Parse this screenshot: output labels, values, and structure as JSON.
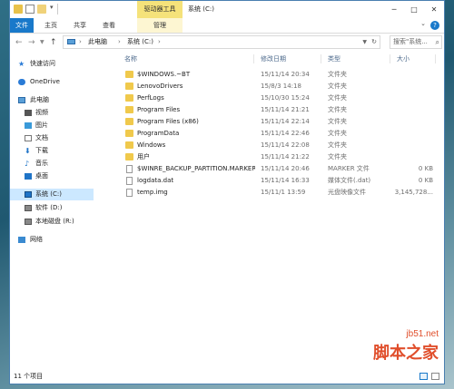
{
  "titlebar": {
    "context_tab_title": "驱动器工具",
    "window_title": "系统 (C:)",
    "dropdown_glyph": "▾"
  },
  "ribbon": {
    "tabs": [
      "文件",
      "主页",
      "共享",
      "查看",
      "管理"
    ],
    "help": "?"
  },
  "address": {
    "segments": [
      "此电脑",
      "系统 (C:)"
    ],
    "search_placeholder": "搜索\"系统...",
    "chevron": "›"
  },
  "sidebar": {
    "items": [
      {
        "label": "快速访问",
        "icon": "star-icon"
      },
      {
        "label": "OneDrive",
        "icon": "cloud-icon"
      },
      {
        "label": "此电脑",
        "icon": "pc-icon"
      },
      {
        "label": "视频",
        "icon": "video-icon"
      },
      {
        "label": "图片",
        "icon": "picture-icon"
      },
      {
        "label": "文档",
        "icon": "document-icon"
      },
      {
        "label": "下载",
        "icon": "download-icon"
      },
      {
        "label": "音乐",
        "icon": "music-icon"
      },
      {
        "label": "桌面",
        "icon": "desktop-icon"
      },
      {
        "label": "系统 (C:)",
        "icon": "windows-drive-icon",
        "selected": true
      },
      {
        "label": "软件 (D:)",
        "icon": "drive-icon"
      },
      {
        "label": "本地磁盘 (R:)",
        "icon": "drive-icon"
      },
      {
        "label": "网络",
        "icon": "network-icon"
      }
    ]
  },
  "list": {
    "columns": [
      "名称",
      "修改日期",
      "类型",
      "大小"
    ],
    "rows": [
      {
        "name": "$WINDOWS.~BT",
        "date": "15/11/14 20:34",
        "type": "文件夹",
        "size": "",
        "kind": "folder"
      },
      {
        "name": "LenovoDrivers",
        "date": "15/8/3 14:18",
        "type": "文件夹",
        "size": "",
        "kind": "folder"
      },
      {
        "name": "PerfLogs",
        "date": "15/10/30 15:24",
        "type": "文件夹",
        "size": "",
        "kind": "folder"
      },
      {
        "name": "Program Files",
        "date": "15/11/14 21:21",
        "type": "文件夹",
        "size": "",
        "kind": "folder"
      },
      {
        "name": "Program Files (x86)",
        "date": "15/11/14 22:14",
        "type": "文件夹",
        "size": "",
        "kind": "folder"
      },
      {
        "name": "ProgramData",
        "date": "15/11/14 22:46",
        "type": "文件夹",
        "size": "",
        "kind": "folder"
      },
      {
        "name": "Windows",
        "date": "15/11/14 22:08",
        "type": "文件夹",
        "size": "",
        "kind": "folder"
      },
      {
        "name": "用户",
        "date": "15/11/14 21:22",
        "type": "文件夹",
        "size": "",
        "kind": "folder"
      },
      {
        "name": "$WINRE_BACKUP_PARTITION.MARKER",
        "date": "15/11/14 20:46",
        "type": "MARKER 文件",
        "size": "0 KB",
        "kind": "file"
      },
      {
        "name": "logdata.dat",
        "date": "15/11/14 16:33",
        "type": "媒体文件(.dat)",
        "size": "0 KB",
        "kind": "file"
      },
      {
        "name": "temp.img",
        "date": "15/11/1 13:59",
        "type": "光盘映像文件",
        "size": "3,145,728...",
        "kind": "file"
      }
    ]
  },
  "status": {
    "item_count": "11 个项目"
  },
  "watermark": {
    "line1": "jb51.net",
    "line2": "脚本之家"
  },
  "colors": {
    "file_tab": "#1979ca",
    "context_tab": "#f5e27a",
    "selected_bg": "#cce8ff",
    "folder": "#f0c94c",
    "watermark": "#e04e2b"
  }
}
